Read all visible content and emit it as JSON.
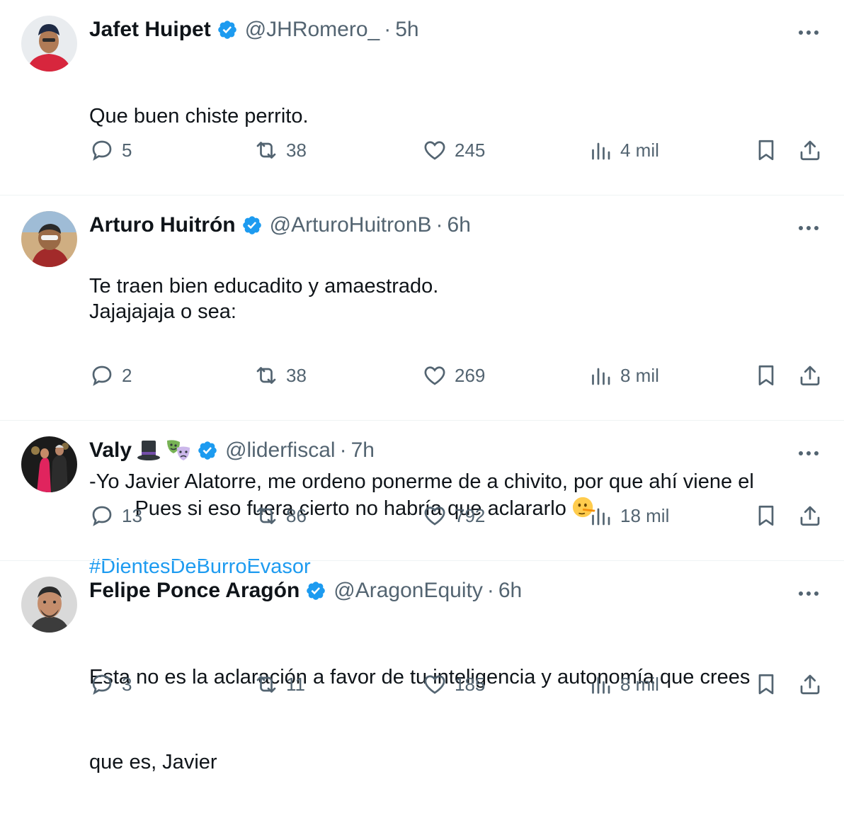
{
  "tweets": [
    {
      "name": "Jafet Huipet",
      "handle": "@JHRomero_",
      "sep": "·",
      "time": "5h",
      "text_lines": [
        "Que buen chiste perrito.",
        "",
        "Te traen bien educadito y amaestrado."
      ],
      "hashtag": "",
      "stats": {
        "replies": "5",
        "reposts": "38",
        "likes": "245",
        "views": "4 mil"
      }
    },
    {
      "name": "Arturo Huitrón",
      "handle": "@ArturoHuitronB",
      "sep": "·",
      "time": "6h",
      "text_lines": [
        "Jajajajaja o sea:",
        "",
        "-Yo Javier Alatorre, me ordeno ponerme de a chivito, por que ahí viene el"
      ],
      "hashtag": "#DientesDeBurroEvasor",
      "stats": {
        "replies": "2",
        "reposts": "38",
        "likes": "269",
        "views": "8 mil"
      }
    },
    {
      "name": "Valy",
      "name_emojis": [
        "top-hat-emoji",
        "performing-arts-emoji"
      ],
      "handle": "@liderfiscal",
      "sep": "·",
      "time": "7h",
      "text_lines": [
        "Pues si eso fuera cierto no habría que aclararlo"
      ],
      "text_emoji": "lying-face-emoji",
      "hashtag": "",
      "stats": {
        "replies": "13",
        "reposts": "86",
        "likes": "792",
        "views": "18 mil"
      }
    },
    {
      "name": "Felipe Ponce Aragón",
      "handle": "@AragonEquity",
      "sep": "·",
      "time": "6h",
      "text_lines": [
        "Esta no es la aclaración a favor de tu inteligencia y autonomía que crees",
        "que es, Javier"
      ],
      "hashtag": "",
      "stats": {
        "replies": "3",
        "reposts": "11",
        "likes": "185",
        "views": "8 mil"
      }
    }
  ],
  "icons": [
    "verified-badge-icon",
    "more-options-icon",
    "reply-icon",
    "repost-icon",
    "like-icon",
    "views-icon",
    "bookmark-icon",
    "share-icon"
  ],
  "colors": {
    "text": "#0f1419",
    "secondary": "#536471",
    "link": "#1d9bf0",
    "verified": "#1d9bf0",
    "divider": "#eff3f4"
  }
}
